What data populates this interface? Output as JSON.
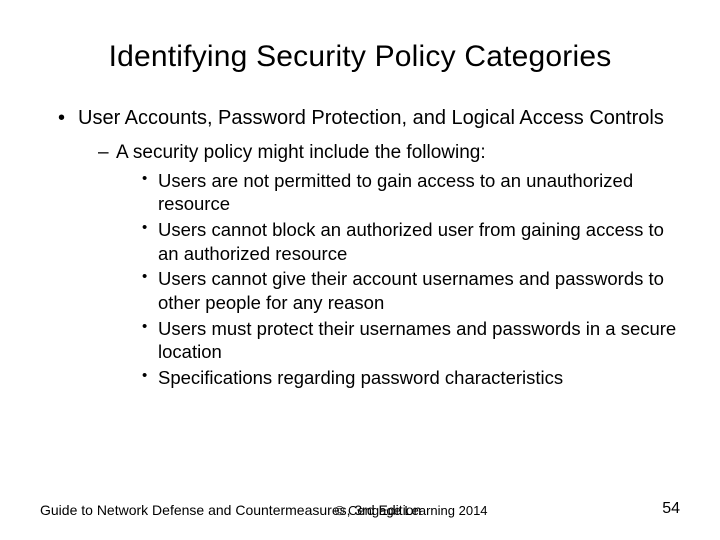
{
  "title": "Identifying Security Policy Categories",
  "bullet1": "User Accounts, Password Protection, and Logical Access Controls",
  "sub1": "A security policy might include the following:",
  "items": [
    "Users are not permitted to gain access to an unauthorized resource",
    "Users cannot block an authorized user from gaining access to an authorized resource",
    "Users cannot give their account usernames and passwords to other people for any reason",
    "Users must protect their usernames and passwords in a secure location",
    "Specifications regarding password characteristics"
  ],
  "footer": {
    "left": "Guide to Network Defense and Countermeasures, 3rd Edition",
    "center": "© Cengage Learning  2014",
    "page": "54"
  }
}
